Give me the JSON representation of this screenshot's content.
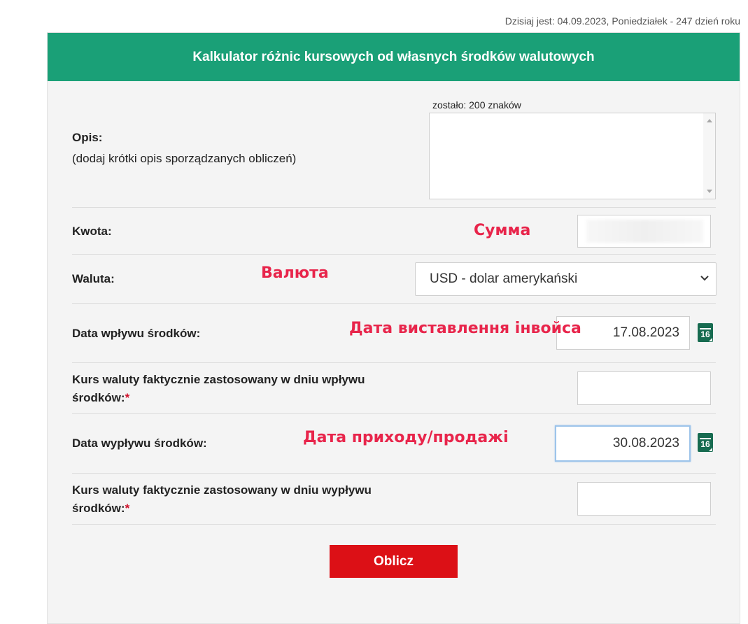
{
  "date_line": "Dzisiaj jest: 04.09.2023, Poniedziałek - 247 dzień roku",
  "title": "Kalkulator różnic kursowych od własnych środków walutowych",
  "opis": {
    "label": "Opis:",
    "hint": "(dodaj krótki opis sporządzanych obliczeń)",
    "counter": "zostało: 200 znaków",
    "value": ""
  },
  "kwota": {
    "label": "Kwota:",
    "value": ""
  },
  "waluta": {
    "label": "Waluta:",
    "selected": "USD - dolar amerykański"
  },
  "data_wplywu": {
    "label": "Data wpływu środków:",
    "value": "17.08.2023",
    "calendar_day": "16"
  },
  "kurs_wplywu": {
    "label_line1": "Kurs waluty faktycznie zastosowany w dniu wpływu",
    "label_line2": "środków:",
    "required_mark": "*",
    "value": ""
  },
  "data_wyplywu": {
    "label": "Data wypływu środków:",
    "value": "30.08.2023",
    "calendar_day": "16"
  },
  "kurs_wyplywu": {
    "label_line1": "Kurs waluty faktycznie zastosowany w dniu wypływu",
    "label_line2": "środków:",
    "required_mark": "*",
    "value": ""
  },
  "submit_label": "Oblicz",
  "annotations": {
    "suma": "Сумма",
    "valuta": "Валюта",
    "data_invoice": "Дата виставлення інвойса",
    "data_prodazh": "Дата приходу/продажі"
  },
  "colors": {
    "header": "#1aa077",
    "button": "#dc1016",
    "annotation": "#e8254b",
    "calendar": "#176b50"
  },
  "icons": {
    "calendar": "calendar-icon",
    "select_arrow": "chevron-down-icon"
  }
}
